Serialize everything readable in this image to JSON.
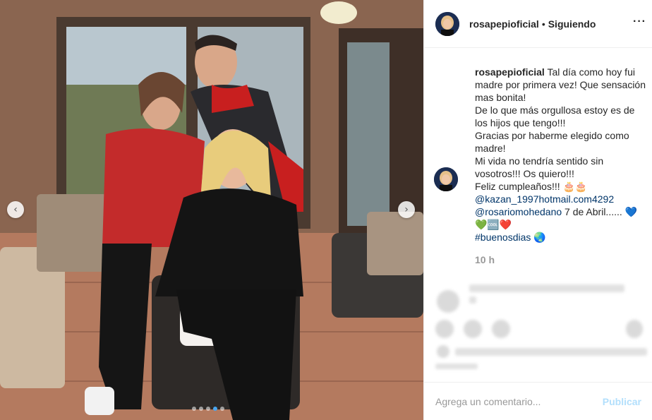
{
  "post": {
    "username": "rosapepioficial",
    "separator": "•",
    "follow_status": "Siguiendo",
    "more_icon": "more-dots-icon",
    "caption": {
      "username": "rosapepioficial",
      "lines": [
        "Tal día como hoy fui",
        "madre por primera vez! Que sensación",
        "mas bonita!",
        "De lo que más orgullosa estoy es de",
        "los hijos que tengo!!!",
        "Gracias por haberme elegido como",
        "madre!",
        "Mi vida no tendría sentido sin",
        "vosotros!!! Os quiero!!!",
        "Feliz cumpleaños!!! 🎂🎂"
      ],
      "mention1": "@kazan_1997hotmail.com4292",
      "mention2": "@rosariomohedano",
      "date_text": " 7 de Abril...... 💙",
      "emoji_line": "💚🆒❤️",
      "hashtag": "#buenosdias",
      "hashtag_emoji": " 🌏"
    },
    "time_ago": "10 h",
    "comment_placeholder": "Agrega un comentario...",
    "publish_label": "Publicar"
  },
  "carousel": {
    "prev_icon": "chevron-left-icon",
    "next_icon": "chevron-right-icon",
    "slide_count": 5,
    "active_slide": 4
  },
  "colors": {
    "link": "#003569",
    "muted": "#999999",
    "publish_disabled": "#b2dffc",
    "dot_active": "#4aa6f0"
  }
}
